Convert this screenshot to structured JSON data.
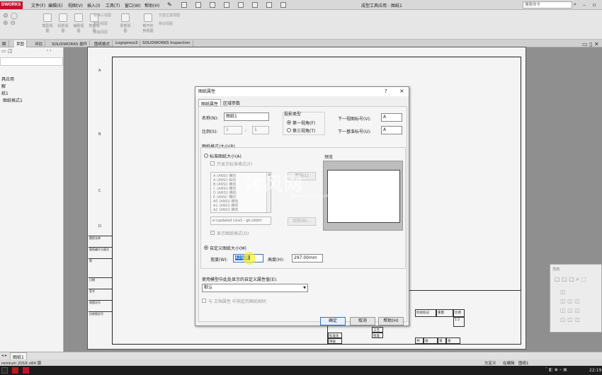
{
  "app": {
    "logo": "DWORKS",
    "title": "成型工具应用 - 图纸1",
    "search_placeholder": "搜索命令",
    "menu": [
      "文件(F)",
      "编辑(E)",
      "视图(V)",
      "插入(I)",
      "工具(T)",
      "窗口(W)",
      "帮助(H)"
    ]
  },
  "ribbon": {
    "labels": [
      "模型视图",
      "投影视图",
      "辅助视图",
      "剖面视图",
      "局部视图",
      "断开的剖视图",
      "标准三视图",
      "断裂视图",
      "剪裁视图",
      "交替位置视图",
      "移动视图"
    ]
  },
  "command_tabs": [
    "解",
    "草图",
    "评估",
    "SOLIDWORKS 插件",
    "图纸格式",
    "Logopress3",
    "SOLIDWORKS Inspection"
  ],
  "tree": [
    "具应用",
    "解",
    "纸1",
    "图纸格式1"
  ],
  "zones": {
    "left": [
      "A",
      "B",
      "C",
      "D"
    ]
  },
  "left_title_block": [
    "图纸名称",
    "图纸编号与版次",
    "第",
    "日期",
    "签字",
    "底图总号",
    "旧底图总号"
  ],
  "title_block": {
    "headers": [
      "阶段标记",
      "重量",
      "比例"
    ],
    "scale": "1:2",
    "rows": [
      "工艺",
      "批准",
      "标准化",
      "审核"
    ],
    "bottom": [
      "共",
      "张",
      "第",
      "张"
    ]
  },
  "dialog": {
    "title": "图纸属性",
    "help_icon": "?",
    "close_icon": "×",
    "tabs": [
      "图纸属性",
      "区域参数"
    ],
    "name_label": "名称(N):",
    "name_value": "图纸1",
    "scale_label": "比例(S):",
    "scale_left": "1",
    "scale_sep": ":",
    "scale_right": "1",
    "projection_label": "投影类型",
    "projection_options": [
      "第一视角(F)",
      "第三视角(T)"
    ],
    "projection_selected": 0,
    "next_view_label": "下一视图标号(V):",
    "next_view_value": "A",
    "next_datum_label": "下一基准标号(U):",
    "next_datum_value": "A",
    "format_size_label": "图纸格式/大小(R)",
    "standard_label": "标准图纸大小(A)",
    "only_standard_label": "只显示标准格式(F)",
    "paper_list": [
      "A (ANSI) 横向",
      "A (ANSI) 纵向",
      "B (ANSI) 横向",
      "C (ANSI) 横向",
      "D (ANSI) 横向",
      "E (ANSI) 横向",
      "A0 (ANSI) 横向",
      "A1 (ANSI) 横向",
      "A2 (ANSI) 横向"
    ],
    "reload_button": "重装(L)",
    "browse_path": "e:\\updated cs\\a3 - gb.slddrt",
    "browse_button": "浏览(B)...",
    "show_format_label": "显示图纸格式(D)",
    "preview_label": "预览",
    "custom_size_label": "自定义图纸大小(M)",
    "width_label": "宽度(W):",
    "width_value": "420.00",
    "height_label": "高度(H):",
    "height_value": "297.00mm",
    "custom_prop_label": "使用模型中此处显示的自定义属性值(E):",
    "custom_prop_value": "默认",
    "same_as_doc_label": "与 文档属性 中指定的图纸相同",
    "ok_button": "确定",
    "cancel_button": "取消",
    "help_button": "帮助(H)"
  },
  "sheet_tabs": [
    "图纸1"
  ],
  "status": {
    "left": "remium 2016 x64 版",
    "right": [
      "欠定义",
      "在编辑",
      "图纸1"
    ]
  },
  "taskbar": {
    "clock": "22:19"
  },
  "float_panel": {
    "title": "方向"
  },
  "watermark": {
    "text": "沐风网",
    "url": "www.mfcad.com"
  },
  "colors": {
    "accent": "#2e73c8",
    "logo_red": "#c8102e",
    "cursor_highlight": "#ffe000"
  }
}
